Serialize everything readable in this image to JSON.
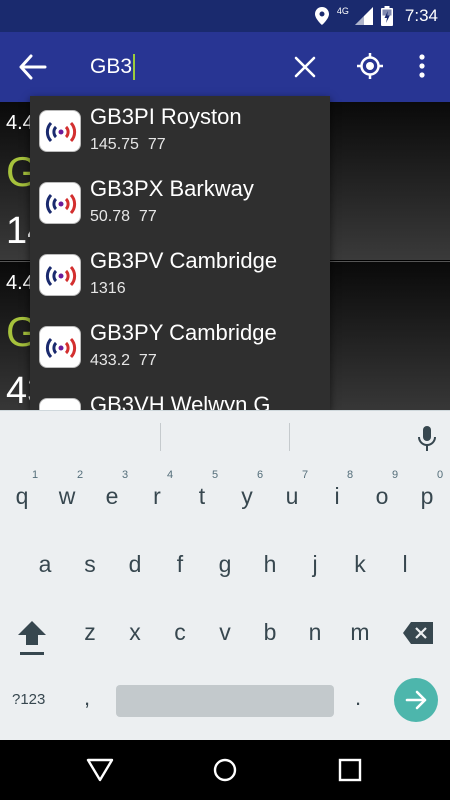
{
  "status_bar": {
    "network_label": "4G",
    "time": "7:34",
    "icons": [
      "location-icon",
      "signal-icon",
      "battery-charging-icon"
    ]
  },
  "app_bar": {
    "search_value": "GB3",
    "icons": [
      "back-arrow-icon",
      "clear-icon",
      "my-location-icon",
      "more-vert-icon"
    ]
  },
  "background_rows": [
    {
      "small": "4.4",
      "big": "G",
      "bottom": "14"
    },
    {
      "small": "4.4",
      "big": "G",
      "bottom": "43"
    }
  ],
  "suggestions": [
    {
      "name": "GB3PI Royston",
      "sub": "145.75  77"
    },
    {
      "name": "GB3PX Barkway",
      "sub": "50.78  77"
    },
    {
      "name": "GB3PV Cambridge",
      "sub": "1316"
    },
    {
      "name": "GB3PY Cambridge",
      "sub": "433.2  77"
    },
    {
      "name": "GB3VH Welwyn G",
      "sub": ""
    }
  ],
  "keyboard": {
    "row1": [
      {
        "k": "q",
        "h": "1"
      },
      {
        "k": "w",
        "h": "2"
      },
      {
        "k": "e",
        "h": "3"
      },
      {
        "k": "r",
        "h": "4"
      },
      {
        "k": "t",
        "h": "5"
      },
      {
        "k": "y",
        "h": "6"
      },
      {
        "k": "u",
        "h": "7"
      },
      {
        "k": "i",
        "h": "8"
      },
      {
        "k": "o",
        "h": "9"
      },
      {
        "k": "p",
        "h": "0"
      }
    ],
    "row2": [
      "a",
      "s",
      "d",
      "f",
      "g",
      "h",
      "j",
      "k",
      "l"
    ],
    "row3": [
      "z",
      "x",
      "c",
      "v",
      "b",
      "n",
      "m"
    ],
    "symbols_label": "?123",
    "comma": ",",
    "period": ".",
    "accent_color": "#4db6ac"
  },
  "colors": {
    "status_bar": "#1a2a6e",
    "app_bar": "#283593",
    "cursor": "#9ccc3c",
    "dropdown": "#2f2f2f",
    "bg_green_text": "#a6c23c"
  }
}
